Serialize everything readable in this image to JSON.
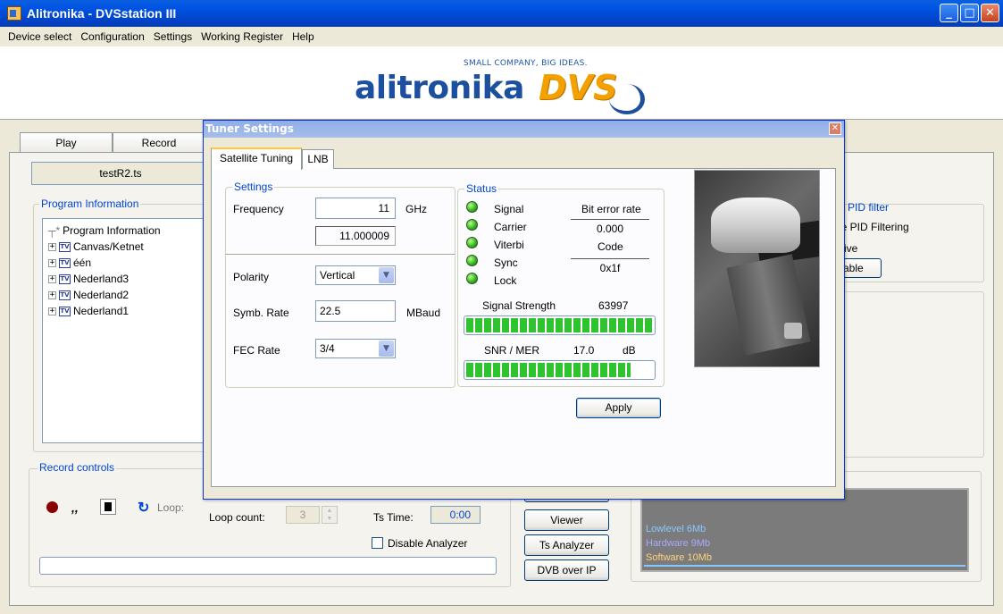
{
  "window": {
    "title": "Alitronika - DVSstation III"
  },
  "menu": [
    "Device select",
    "Configuration",
    "Settings",
    "Working Register",
    "Help"
  ],
  "logo": {
    "tagline": "SMALL COMPANY, BIG IDEAS.",
    "word": "alitronika",
    "brand": "DVS"
  },
  "main_tabs": {
    "play": "Play",
    "record": "Record"
  },
  "file_name": "testR2.ts",
  "program_info": {
    "group_label": "Program Information",
    "root": "Program Information",
    "items": [
      "Canvas/Ketnet",
      "één",
      "Nederland3",
      "Nederland2",
      "Nederland1"
    ]
  },
  "record_controls": {
    "label": "Record controls",
    "loop_label": "Loop:",
    "loop_count_label": "Loop count:",
    "loop_count": "3",
    "ts_time_label": "Ts Time:",
    "ts_time": "0:00",
    "disable_analyzer": "Disable Analyzer"
  },
  "side_buttons": {
    "viewer": "Viewer",
    "ts_analyzer": "Ts Analyzer",
    "dvb_over_ip": "DVB over IP"
  },
  "pid_filter": {
    "label": "e PID filter",
    "text1": "le PID Filtering",
    "text2": "sive",
    "button": "able"
  },
  "bitrate": {
    "lowlevel": "Lowlevel 6Mb",
    "hardware": "Hardware 9Mb",
    "software": "Software 10Mb"
  },
  "dialog": {
    "title": "Tuner Settings",
    "tabs": [
      "Satellite Tuning",
      "LNB"
    ],
    "settings": {
      "label": "Settings",
      "frequency_label": "Frequency",
      "frequency": "11",
      "frequency_unit": "GHz",
      "frequency_actual": "11.000009",
      "polarity_label": "Polarity",
      "polarity": "Vertical",
      "symb_rate_label": "Symb. Rate",
      "symb_rate": "22.5",
      "symb_rate_unit": "MBaud",
      "fec_label": "FEC Rate",
      "fec": "3/4"
    },
    "status": {
      "label": "Status",
      "indicators": [
        "Signal",
        "Carrier",
        "Viterbi",
        "Sync",
        "Lock"
      ],
      "ber_label": "Bit error rate",
      "ber": "0.000",
      "code_label": "Code",
      "code": "0x1f",
      "signal_strength_label": "Signal Strength",
      "signal_strength": "63997",
      "snr_label": "SNR / MER",
      "snr": "17.0",
      "snr_unit": "dB",
      "signal_strength_fraction": 1.0,
      "snr_fraction": 0.88
    },
    "apply": "Apply"
  },
  "colors": {
    "led_on": "#2fae1c",
    "meter": "#2fc42f",
    "lowlevel": "#87c8ff",
    "hardware": "#a9a9ff",
    "software": "#ffd27a"
  }
}
